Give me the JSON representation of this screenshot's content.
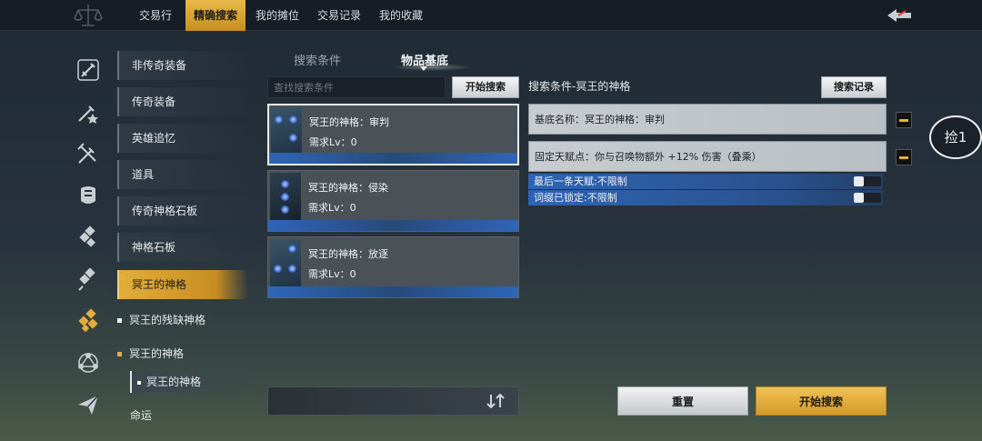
{
  "topbar": {
    "tabs": [
      {
        "label": "交易行"
      },
      {
        "label": "精确搜索"
      },
      {
        "label": "我的摊位"
      },
      {
        "label": "交易记录"
      },
      {
        "label": "我的收藏"
      }
    ],
    "active_tab": "精确搜索"
  },
  "rail_icons": [
    "sword-icon",
    "sword-star-icon",
    "sword-check-icon",
    "armor-icon",
    "board-icon",
    "board-icon",
    "board-gold-icon",
    "network-icon",
    "paper-plane-icon"
  ],
  "categories": [
    {
      "label": "非传奇装备"
    },
    {
      "label": "传奇装备"
    },
    {
      "label": "英雄追忆"
    },
    {
      "label": "道具"
    },
    {
      "label": "传奇神格石板"
    },
    {
      "label": "神格石板"
    },
    {
      "label": "冥王的神格"
    }
  ],
  "subcategories": [
    {
      "label": "冥王的残缺神格"
    },
    {
      "label": "冥王的神格"
    }
  ],
  "subsub": {
    "label": "冥王的神格"
  },
  "more_category": {
    "label": "命运"
  },
  "panel_tabs": [
    {
      "label": "搜索条件"
    },
    {
      "label": "物品基底"
    }
  ],
  "search": {
    "placeholder": "查找搜索条件",
    "button": "开始搜索"
  },
  "items": [
    {
      "name": "冥王的神格：审判",
      "req": "需求Lv：0"
    },
    {
      "name": "冥王的神格：侵染",
      "req": "需求Lv：0"
    },
    {
      "name": "冥王的神格：放逐",
      "req": "需求Lv：0"
    }
  ],
  "conditions": {
    "title": "搜索条件-冥王的神格",
    "history_button": "搜索记录",
    "rows": [
      {
        "text": "基底名称：冥王的神格：审判"
      },
      {
        "text": "固定天赋点：你与召唤物额外 +12% 伤害（叠乘）"
      }
    ],
    "options": [
      {
        "text": "最后一条天赋:不限制"
      },
      {
        "text": "词缀已锁定:不限制"
      }
    ]
  },
  "loot_button": "捡1",
  "actions": {
    "reset": "重置",
    "search": "开始搜索"
  },
  "colors": {
    "accent": "#e2ad3a",
    "highlight_blue": "#2e64b3"
  }
}
